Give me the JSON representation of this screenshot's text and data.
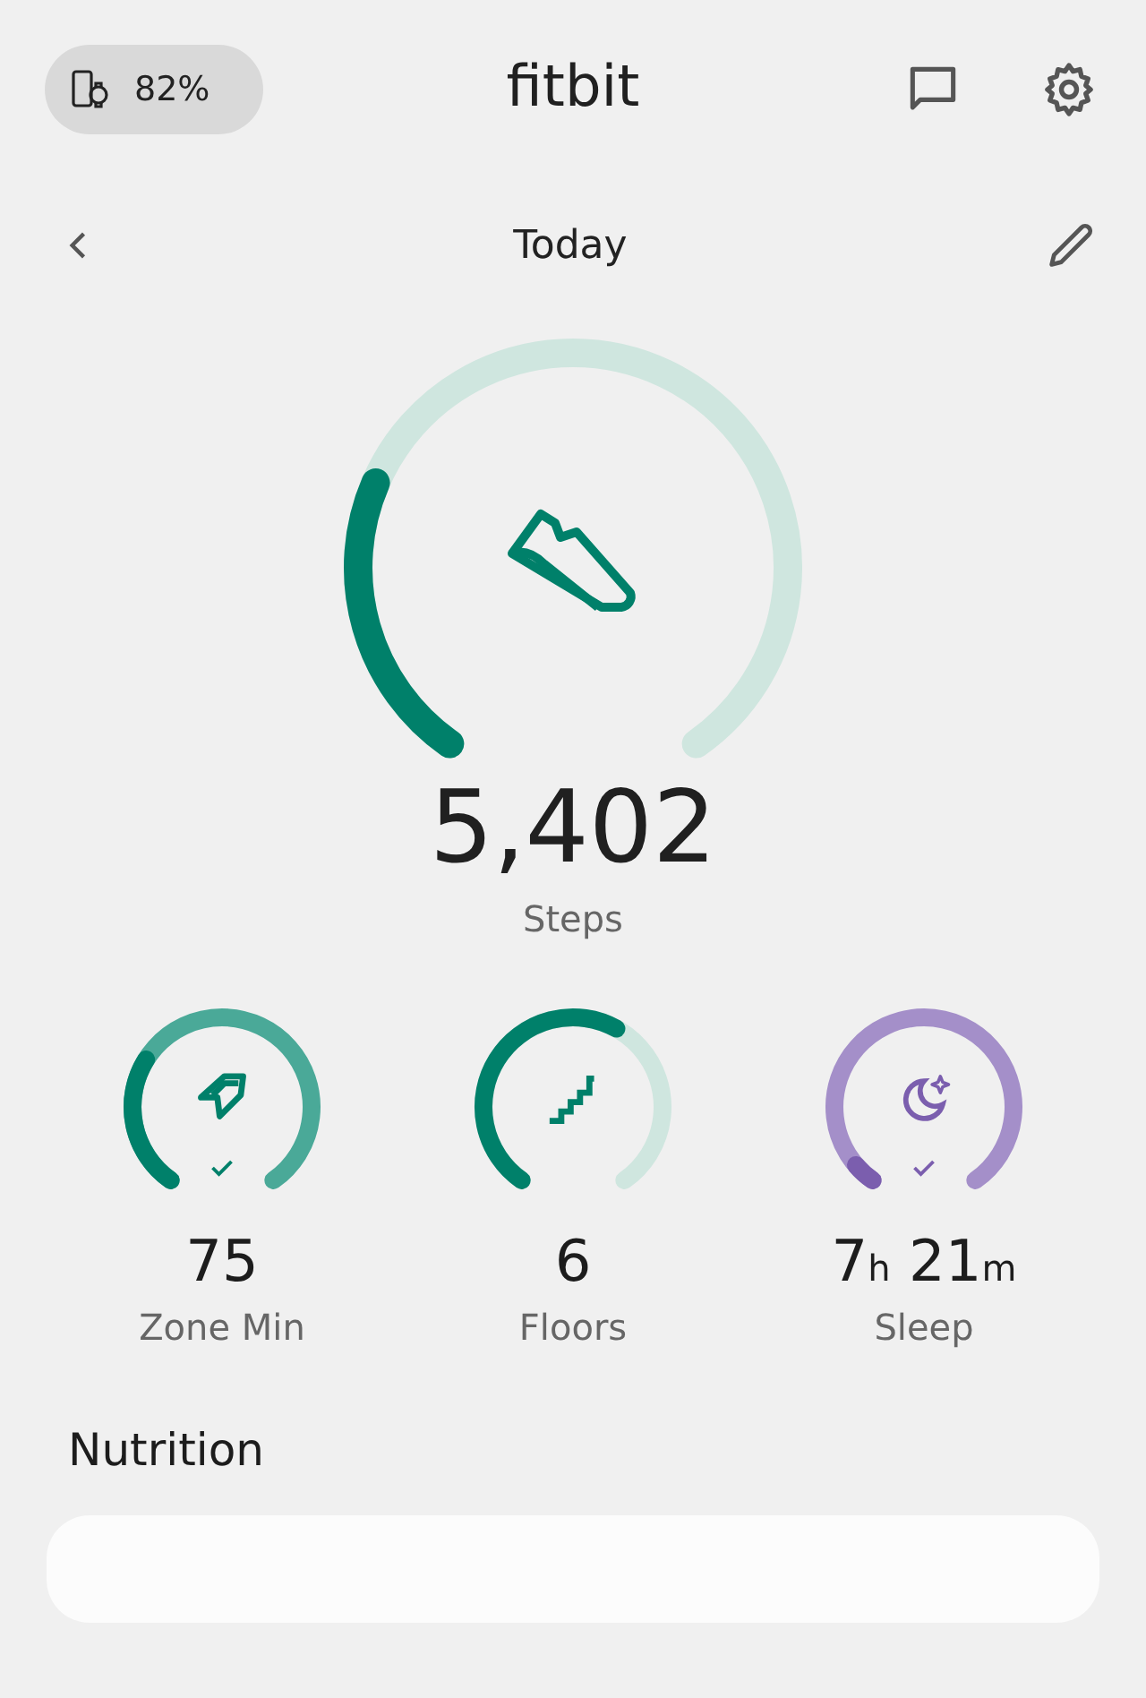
{
  "header": {
    "battery": "82%",
    "logo": "fitbit"
  },
  "date_bar": {
    "title": "Today"
  },
  "main": {
    "value": "5,402",
    "label": "Steps",
    "ring": {
      "color": "#00806a",
      "goal_met": false
    }
  },
  "stats": [
    {
      "kind": "zone",
      "label": "Zone Min",
      "value_parts": [
        {
          "kind": "number",
          "text": "75"
        }
      ],
      "ring": {
        "color": "#4aa998",
        "goal_met": true,
        "lap": {
          "color": "#00806a"
        }
      }
    },
    {
      "kind": "floors",
      "label": "Floors",
      "value_parts": [
        {
          "kind": "number",
          "text": "6"
        }
      ],
      "ring": {
        "color": "#00806a",
        "goal_met": false
      }
    },
    {
      "kind": "sleep",
      "label": "Sleep",
      "value_parts": [
        {
          "kind": "number",
          "text": "7"
        },
        {
          "kind": "unit",
          "text": "h"
        },
        {
          "kind": "number",
          "text": " 21"
        },
        {
          "kind": "unit",
          "text": "m"
        }
      ],
      "ring": {
        "color": "#a48fc9",
        "goal_met": true,
        "lap": {
          "color": "#7b5eae"
        }
      }
    }
  ],
  "section": {
    "title": "Nutrition"
  }
}
